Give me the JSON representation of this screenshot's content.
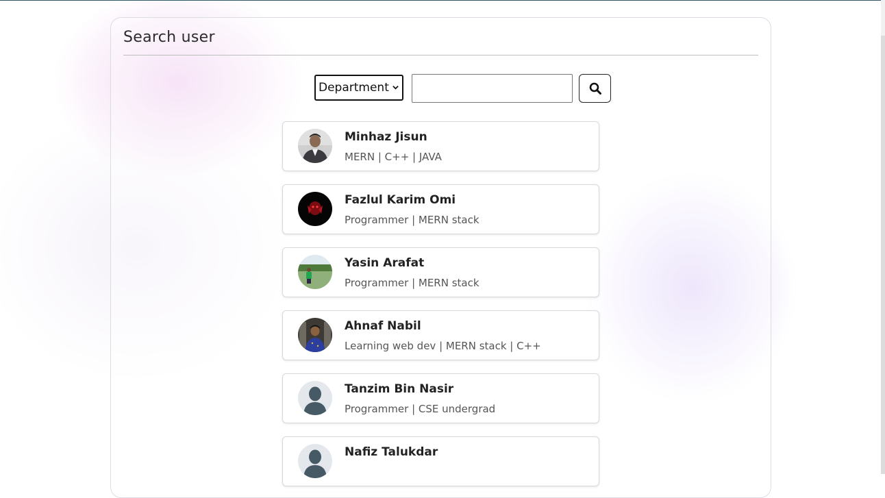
{
  "panel": {
    "title": "Search user"
  },
  "search": {
    "department_selected": "Department",
    "query_value": "",
    "query_placeholder": "",
    "button_icon": "search-icon"
  },
  "users": [
    {
      "name": "Minhaz Jisun",
      "description": "MERN | C++ | JAVA",
      "avatar": "photo"
    },
    {
      "name": "Fazlul Karim Omi",
      "description": "Programmer | MERN stack",
      "avatar": "photo"
    },
    {
      "name": "Yasin Arafat",
      "description": "Programmer | MERN stack",
      "avatar": "photo"
    },
    {
      "name": "Ahnaf Nabil",
      "description": "Learning web dev | MERN stack | C++",
      "avatar": "photo"
    },
    {
      "name": "Tanzim Bin Nasir",
      "description": "Programmer | CSE undergrad",
      "avatar": "default-user-icon"
    },
    {
      "name": "Nafiz Talukdar",
      "description": "",
      "avatar": "default-user-icon"
    }
  ],
  "colors": {
    "accent_line": "#2f5a66",
    "default_avatar_bg": "#e4e8ec",
    "default_avatar_fg": "#455a64"
  }
}
